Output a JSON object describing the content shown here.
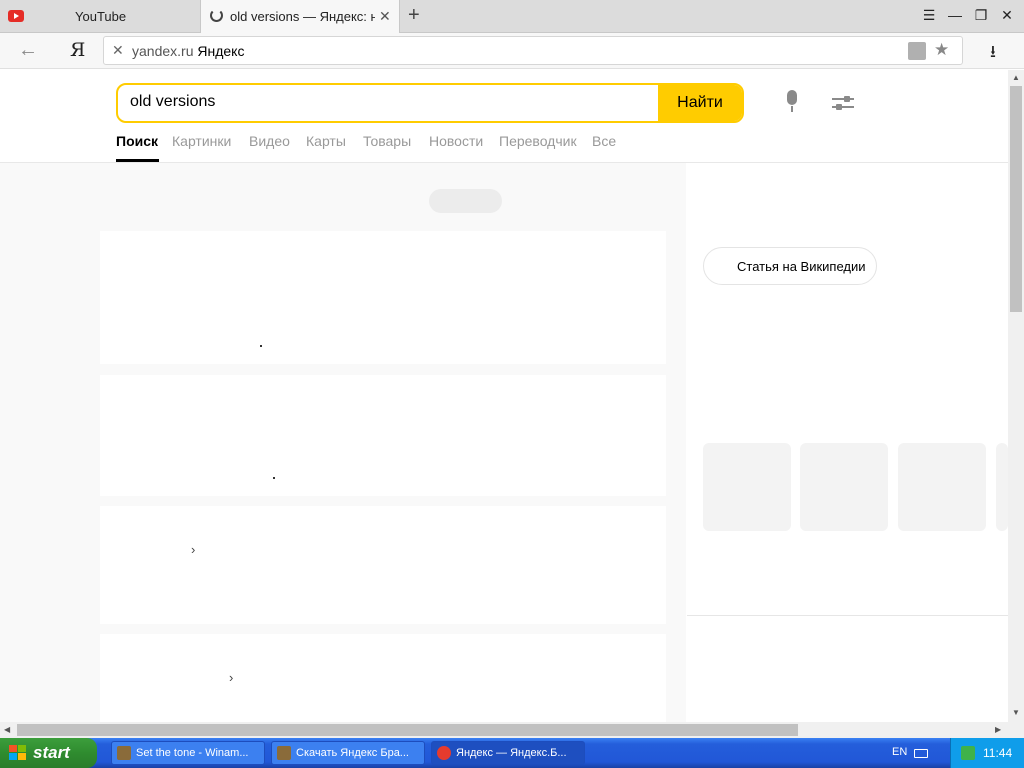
{
  "tabs": [
    {
      "title": "YouTube"
    },
    {
      "title": "old versions — Яндекс: нашлось"
    }
  ],
  "addressbar": {
    "domain": "yandex.ru",
    "site_name": "Яндекс"
  },
  "search": {
    "query": "old versions",
    "button_label": "Найти"
  },
  "nav": [
    "Поиск",
    "Картинки",
    "Видео",
    "Карты",
    "Товары",
    "Новости",
    "Переводчик",
    "Все"
  ],
  "wiki_button": "Статья на Википедии",
  "taskbar": {
    "start_label": "start",
    "items": [
      "Set the tone - Winam...",
      "Скачать Яндекс Бра...",
      "Яндекс — Яндекс.Б..."
    ],
    "lang": "EN",
    "clock": "11:44"
  },
  "colors": {
    "accent": "#ffcc00",
    "taskbar": "#245edb",
    "start": "#2f8c2f"
  }
}
